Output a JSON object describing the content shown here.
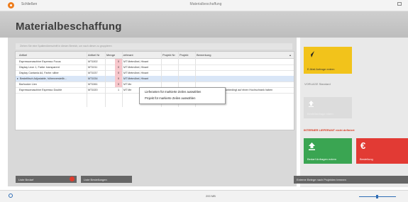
{
  "window": {
    "close_label": "Schließen",
    "title": "Materialbeschaffung"
  },
  "page": {
    "title": "Materialbeschaffung"
  },
  "grid": {
    "group_hint": "Ziehen Sie eine Spaltenüberschrift in diesen Bereich, um nach dieser zu gruppieren",
    "columns": [
      "Artikel",
      "Artikel Nr",
      "Menge",
      "Lieferant",
      "Projekt Nr",
      "Projekt",
      "Bemerkung"
    ],
    "rows": [
      {
        "artikel": "Espressomaschine Espresso Focus",
        "nr": "MT1002",
        "menge": "0",
        "lieferant": "MT Metmöbel, Hinant",
        "bemerkung": ""
      },
      {
        "artikel": "Display Leon 1, Farbe: transparent",
        "nr": "MT1011",
        "menge": "0",
        "lieferant": "MT Metmöbel, Hinant",
        "bemerkung": ""
      },
      {
        "artikel": "Display Cantania A4, Farbe: silber",
        "nr": "MT1037",
        "menge": "0",
        "lieferant": "MT Metmöbel, Hinant",
        "bemerkung": ""
      },
      {
        "artikel": "Bestelltisch Adjustable, höhenverstellb...",
        "nr": "MT1034",
        "menge": "0",
        "lieferant": "MT Metmöbel, Hinant",
        "bemerkung": ""
      },
      {
        "artikel": "Barhocker Lien",
        "nr": "MT1061",
        "menge": "0",
        "lieferant": "MT Me",
        "bemerkung": ""
      },
      {
        "artikel": "Espressomaschine Espresso Double",
        "nr": "MT1020",
        "menge": "1",
        "lieferant": "MT Me",
        "bemerkung": "unbedingt auf einen Hochschrank haben"
      }
    ]
  },
  "context_menu": {
    "items": [
      "Lieferanten für markierte Zeilen auswählen",
      "Projekt für markierte Zeilen auswählen"
    ]
  },
  "buttons": {
    "liste_bedarf": "Liste Bedarf",
    "liste_bestellungen": "Liste Bestellungen",
    "bottom_right": "Externe Belege nach Projekten trennen"
  },
  "right_panel": {
    "email_tile": "E-Mail Anfrage extern",
    "vorlage_label": "VORLAGE Standard",
    "disabled_tile": "Bestellanfrage intern",
    "warning_text": "INTERNER LIEFERANT nicht definiert",
    "bedarf_tile": "Bedarf Anfragen extern",
    "bestellung_tile": "Bestellung",
    "euro_symbol": "€"
  },
  "status": {
    "count": "200 MB"
  },
  "colors": {
    "yellow": "#f2c31b",
    "green": "#3aa552",
    "red": "#e23a34",
    "warning": "#d9391f"
  }
}
